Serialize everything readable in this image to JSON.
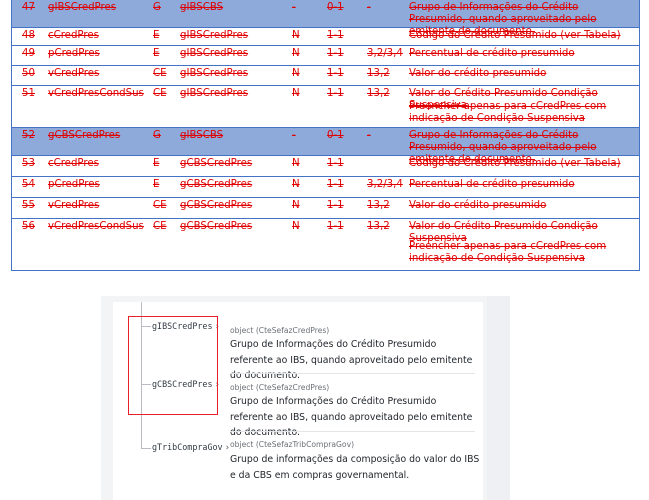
{
  "table": {
    "rows": [
      {
        "num": "47",
        "field": "gIBSCredPres",
        "tipo": "G",
        "pai": "gIBSCBS",
        "n": "-",
        "card": "0-1",
        "tam": "-",
        "desc": "Grupo de Informações do Crédito Presumido, quando aproveitado pelo emitente do documento.",
        "group": true
      },
      {
        "num": "48",
        "field": "cCredPres",
        "tipo": "E",
        "pai": "gIBSCredPres",
        "n": "N",
        "card": "1-1",
        "tam": "",
        "desc": "Código do Crédito Presumido (ver Tabela)",
        "group": false
      },
      {
        "num": "49",
        "field": "pCredPres",
        "tipo": "E",
        "pai": "gIBSCredPres",
        "n": "N",
        "card": "1-1",
        "tam": "3,2/3,4",
        "desc": "Percentual  de crédito presumido",
        "group": false
      },
      {
        "num": "50",
        "field": "vCredPres",
        "tipo": "CE",
        "pai": "gIBSCredPres",
        "n": "N",
        "card": "1-1",
        "tam": "13,2",
        "desc": "Valor do crédito presumido",
        "group": false
      },
      {
        "num": "51",
        "field": "vCredPresCondSus",
        "tipo": "CE",
        "pai": "gIBSCredPres",
        "n": "N",
        "card": "1-1",
        "tam": "13,2",
        "desc": "Valor do Crédito Presumido Condição Suspensiva",
        "desc2": "Preencher apenas para cCredPres com indicação de Condição Suspensiva",
        "group": false
      },
      {
        "num": "52",
        "field": "gCBSCredPres",
        "tipo": "G",
        "pai": "gIBSCBS",
        "n": "-",
        "card": "0-1",
        "tam": "-",
        "desc": "Grupo de Informações do Crédito Presumido, quando aproveitado pelo emitente do documento.",
        "group": true
      },
      {
        "num": "53",
        "field": "cCredPres",
        "tipo": "E",
        "pai": "gCBSCredPres",
        "n": "N",
        "card": "1-1",
        "tam": "",
        "desc": "Código do Crédito Presumido (ver Tabela)",
        "group": false
      },
      {
        "num": "54",
        "field": "pCredPres",
        "tipo": "E",
        "pai": "gCBSCredPres",
        "n": "N",
        "card": "1-1",
        "tam": "3,2/3,4",
        "desc": "Percentual  de crédito presumido",
        "group": false
      },
      {
        "num": "55",
        "field": "vCredPres",
        "tipo": "CE",
        "pai": "gCBSCredPres",
        "n": "N",
        "card": "1-1",
        "tam": "13,2",
        "desc": "Valor do crédito presumido",
        "group": false
      },
      {
        "num": "56",
        "field": "vCredPresCondSus",
        "tipo": "CE",
        "pai": "gCBSCredPres",
        "n": "N",
        "card": "1-1",
        "tam": "13,2",
        "desc": "Valor do Crédito Presumido Condição Suspensiva",
        "desc2": "Preencher apenas para cCredPres com indicação de Condição Suspensiva",
        "group": false
      }
    ]
  },
  "doc": {
    "props": [
      {
        "name": "gIBSCredPres",
        "type": "object (CteSefazCredPres)",
        "desc": "Grupo de Informações do Crédito Presumido referente ao IBS, quando aproveitado pelo emitente do documento."
      },
      {
        "name": "gCBSCredPres",
        "type": "object (CteSefazCredPres)",
        "desc": "Grupo de Informações do Crédito Presumido referente ao IBS, quando aproveitado pelo emitente do documento."
      },
      {
        "name": "gTribCompraGov",
        "type": "object (CteSefazTribCompraGov)",
        "desc": "Grupo de informações da composição do valor do IBS e da CBS em compras governamental."
      }
    ],
    "chevron": "›",
    "colors": {
      "highlight": "#e8202a",
      "strike": "#e00000",
      "group_bg": "#8eaadb",
      "border": "#4472c4"
    }
  }
}
